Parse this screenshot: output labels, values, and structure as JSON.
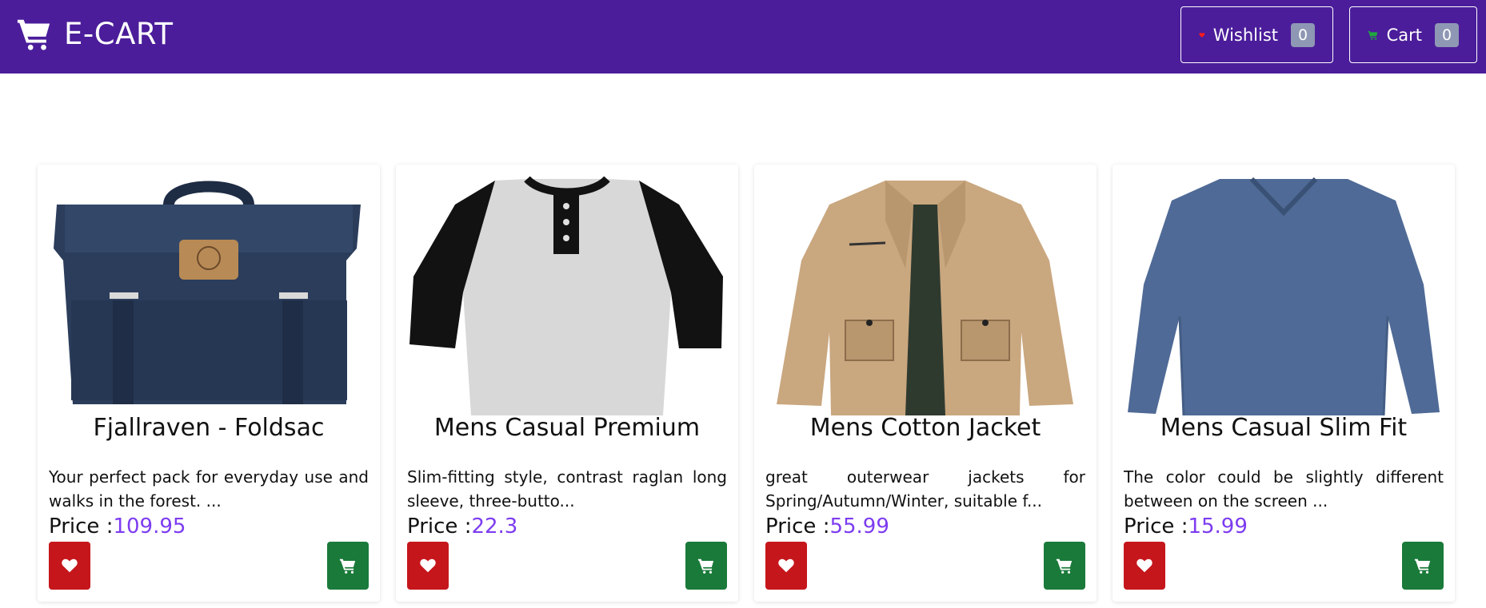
{
  "header": {
    "brand": "E-CART",
    "wishlist": {
      "label": "Wishlist",
      "count": "0"
    },
    "cart": {
      "label": "Cart",
      "count": "0"
    }
  },
  "products": [
    {
      "title": "Fjallraven - Foldsac",
      "description": "Your perfect pack for everyday use and walks in the forest. ...",
      "price_label": "Price :",
      "price": "109.95",
      "image": "navy-backpack"
    },
    {
      "title": "Mens Casual Premium",
      "description": "Slim-fitting style, contrast raglan long sleeve, three-butto...",
      "price_label": "Price :",
      "price": "22.3",
      "image": "raglan-henley-tshirt"
    },
    {
      "title": "Mens Cotton Jacket",
      "description": "great outerwear jackets for Spring/Autumn/Winter, suitable f...",
      "price_label": "Price :",
      "price": "55.99",
      "image": "khaki-cotton-jacket"
    },
    {
      "title": "Mens Casual Slim Fit",
      "description": "The color could be slightly different between on the screen ...",
      "price_label": "Price :",
      "price": "15.99",
      "image": "blue-long-sleeve-shirt"
    }
  ],
  "colors": {
    "navbar": "#4b1d9a",
    "price": "#7d3cf0",
    "wishlist_button": "#c5161c",
    "cart_button": "#1a7a3a",
    "heart_icon": "#ff1a1a",
    "cart_icon_nav": "#1fa83e"
  },
  "icons": {
    "brand": "shopping-cart-icon",
    "wishlist": "heart-icon",
    "cart": "cart-icon"
  }
}
